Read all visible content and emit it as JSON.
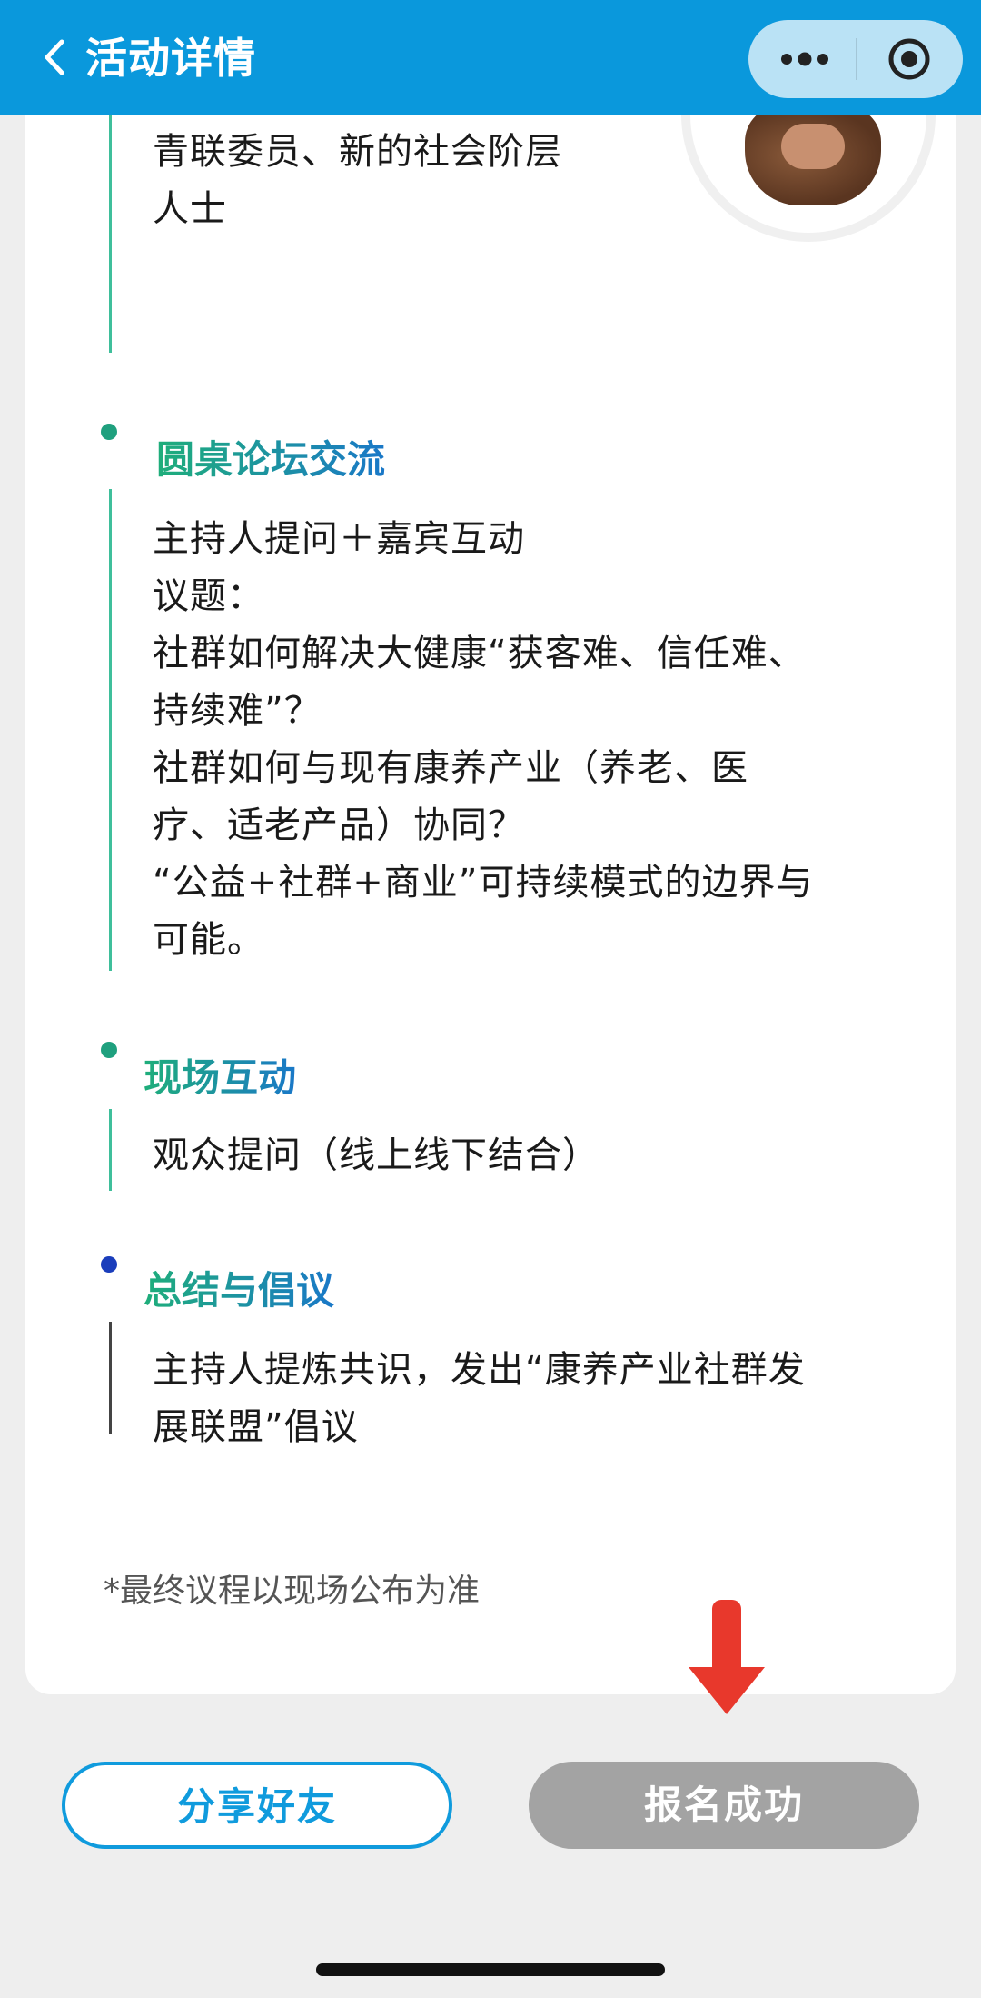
{
  "header": {
    "title": "活动详情"
  },
  "capsule": {
    "more_icon": "more-dots-icon",
    "close_icon": "target-icon"
  },
  "speaker_tail": {
    "lines": [
      "青联委员、新的社会阶层",
      "人士"
    ]
  },
  "sections": [
    {
      "title": "圆桌论坛交流",
      "lines": [
        "主持人提问＋嘉宾互动",
        "议题：",
        "社群如何解决大健康“获客难、信任难、",
        "持续难”？",
        "社群如何与现有康养产业（养老、医",
        "疗、适老产品）协同？",
        "“公益+社群+商业”可持续模式的边界与",
        "可能。"
      ]
    },
    {
      "title": "现场互动",
      "lines": [
        "观众提问（线上线下结合）"
      ]
    },
    {
      "title": "总结与倡议",
      "lines": [
        "主持人提炼共识，发出“康养产业社群发",
        "展联盟”倡议"
      ]
    }
  ],
  "note": "*最终议程以现场公布为准",
  "buttons": {
    "share": "分享好友",
    "registered": "报名成功"
  },
  "colors": {
    "header_bg": "#0a98dc",
    "accent_green": "#1fae7a",
    "accent_blue": "#1a78c8",
    "share_border": "#109bdd",
    "registered_bg": "#a3a3a3",
    "arrow": "#e8382c"
  }
}
